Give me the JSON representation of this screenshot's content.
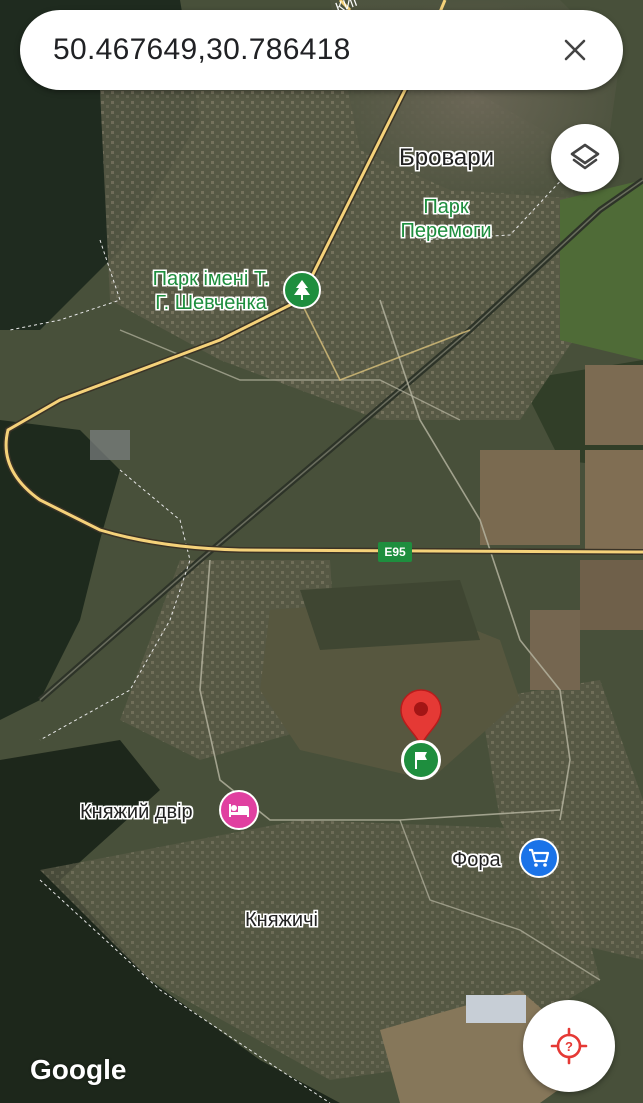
{
  "search": {
    "value": "50.467649,30.786418"
  },
  "map_labels": {
    "city_brovary": "Бровари",
    "park_peremogy_line1": "Парк",
    "park_peremogy_line2": "Перемоги",
    "park_shevchenka_line1": "Парк імені Т.",
    "park_shevchenka_line2": "Г. Шевченка",
    "knyazhyi_dvir": "Княжий двір",
    "fora": "Фора",
    "knyazhychi": "Княжичі",
    "road_e95": "E95",
    "road_top_partial": "КИЇ"
  },
  "attribution": "Google",
  "icons": {
    "close": "close-icon",
    "layers": "layers-icon",
    "locate": "my-location-icon",
    "pin": "location-pin-icon",
    "flag": "flag-icon",
    "park": "tree-icon",
    "hotel": "bed-icon",
    "shop": "shopping-cart-icon"
  },
  "colors": {
    "pin": "#e53935",
    "park": "#1e8e3e",
    "hotel": "#e040a0",
    "shop": "#1a73e8",
    "road": "#f5d27a",
    "locate": "#e53935"
  }
}
